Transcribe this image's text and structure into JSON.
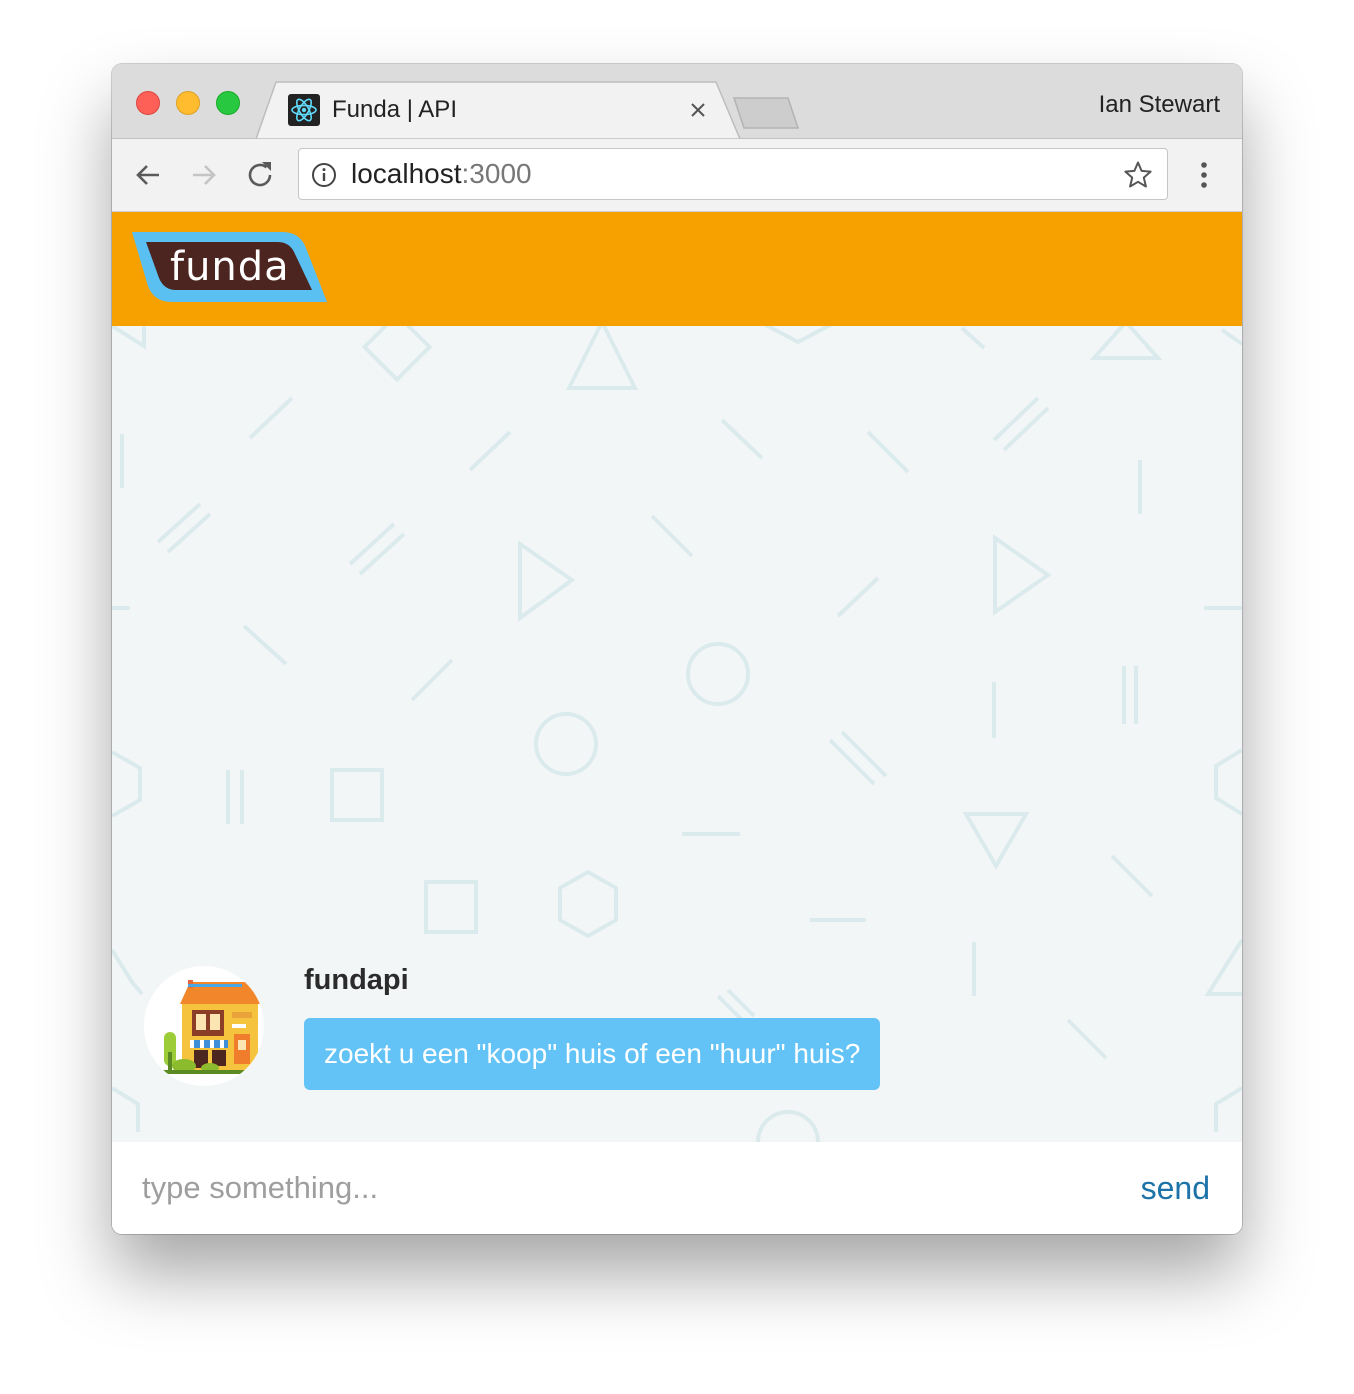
{
  "browser": {
    "tab_title": "Funda | API",
    "tab_close_icon": "close-icon",
    "profile_name": "Ian Stewart",
    "url_host": "localhost",
    "url_port": ":3000",
    "icons": [
      "back-arrow-icon",
      "forward-arrow-icon",
      "reload-icon",
      "info-icon",
      "star-icon",
      "more-vert-icon",
      "react-icon"
    ]
  },
  "site": {
    "logo_text": "funda",
    "header_color": "#f7a100"
  },
  "chat": {
    "messages": [
      {
        "sender": "fundapi",
        "text": "zoekt u een \"koop\" huis of een \"huur\" huis?",
        "bubble_color": "#63c3f7"
      }
    ],
    "composer": {
      "placeholder": "type something...",
      "value": "",
      "send_label": "send",
      "send_color": "#1d72a8"
    }
  }
}
